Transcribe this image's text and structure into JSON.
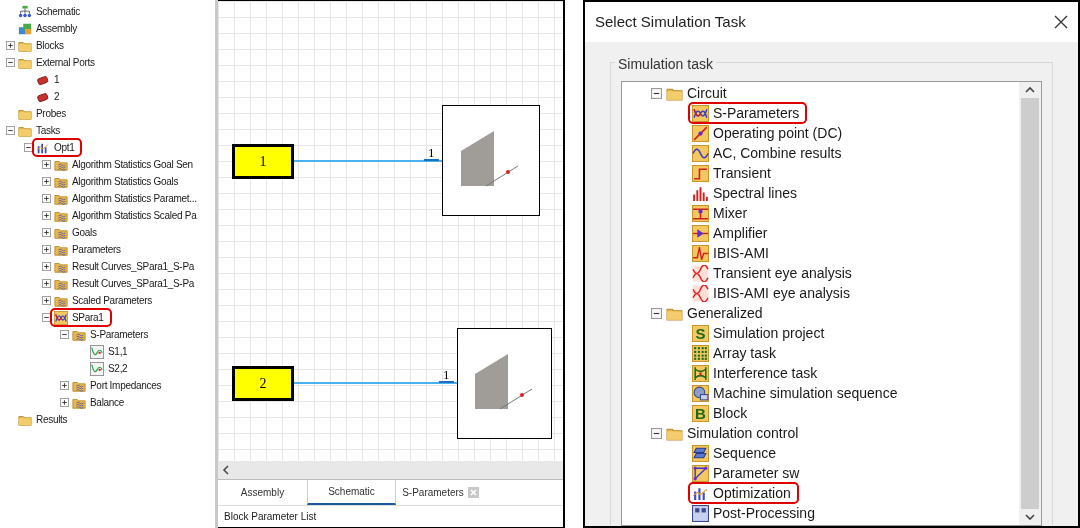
{
  "explorer": {
    "items": [
      {
        "label": "Schematic",
        "kind": "schematic"
      },
      {
        "label": "Assembly",
        "kind": "assembly"
      },
      {
        "label": "Blocks",
        "kind": "folder",
        "expanded": false
      },
      {
        "label": "External Ports",
        "kind": "folder",
        "expanded": true,
        "children": [
          {
            "label": "1",
            "kind": "port"
          },
          {
            "label": "2",
            "kind": "port"
          }
        ]
      },
      {
        "label": "Probes",
        "kind": "folder"
      },
      {
        "label": "Tasks",
        "kind": "folder",
        "expanded": true,
        "children": [
          {
            "label": "Opt1",
            "kind": "optimization",
            "expanded": true,
            "highlighted": true,
            "children": [
              {
                "label": "Algorithm Statistics Goal Sen",
                "kind": "results",
                "expanded": false
              },
              {
                "label": "Algorithm Statistics Goals",
                "kind": "results",
                "expanded": false
              },
              {
                "label": "Algorithm Statistics Paramet...",
                "kind": "results",
                "expanded": false
              },
              {
                "label": "Algorithm Statistics Scaled Pa",
                "kind": "results",
                "expanded": false
              },
              {
                "label": "Goals",
                "kind": "results",
                "expanded": false
              },
              {
                "label": "Parameters",
                "kind": "results",
                "expanded": false
              },
              {
                "label": "Result Curves_SPara1_S-Pa",
                "kind": "results",
                "expanded": false
              },
              {
                "label": "Result Curves_SPara1_S-Pa",
                "kind": "results",
                "expanded": false
              },
              {
                "label": "Scaled Parameters",
                "kind": "results",
                "expanded": false
              },
              {
                "label": "SPara1",
                "kind": "sparameters",
                "expanded": true,
                "highlighted": true,
                "children": [
                  {
                    "label": "S-Parameters",
                    "kind": "results",
                    "expanded": true,
                    "children": [
                      {
                        "label": "S1,1",
                        "kind": "curve"
                      },
                      {
                        "label": "S2,2",
                        "kind": "curve"
                      }
                    ]
                  },
                  {
                    "label": "Port Impedances",
                    "kind": "results",
                    "expanded": false
                  },
                  {
                    "label": "Balance",
                    "kind": "results",
                    "expanded": false
                  }
                ]
              }
            ]
          }
        ]
      },
      {
        "label": "Results",
        "kind": "folder"
      }
    ]
  },
  "schematic": {
    "blocks": [
      {
        "label": "1",
        "pin_label": "1"
      },
      {
        "label": "2",
        "pin_label": "1"
      }
    ],
    "tabs": [
      {
        "label": "Assembly",
        "selected": false,
        "closable": false
      },
      {
        "label": "Schematic",
        "selected": true,
        "closable": false
      },
      {
        "label": "S-Parameters",
        "selected": false,
        "closable": true
      }
    ],
    "status": "Block Parameter List"
  },
  "dialog": {
    "title": "Select Simulation Task",
    "group_label": "Simulation task",
    "tree": [
      {
        "label": "Circuit",
        "kind": "folder",
        "expanded": true,
        "children": [
          {
            "label": "S-Parameters",
            "kind": "sparameters",
            "highlighted": true
          },
          {
            "label": "Operating point (DC)",
            "kind": "dc"
          },
          {
            "label": "AC, Combine results",
            "kind": "ac"
          },
          {
            "label": "Transient",
            "kind": "transient"
          },
          {
            "label": "Spectral lines",
            "kind": "spectral"
          },
          {
            "label": "Mixer",
            "kind": "mixer"
          },
          {
            "label": "Amplifier",
            "kind": "amplifier"
          },
          {
            "label": "IBIS-AMI",
            "kind": "ibis"
          },
          {
            "label": "Transient eye analysis",
            "kind": "eye"
          },
          {
            "label": "IBIS-AMI eye analysis",
            "kind": "eye"
          }
        ]
      },
      {
        "label": "Generalized",
        "kind": "folder",
        "expanded": true,
        "children": [
          {
            "label": "Simulation project",
            "kind": "letter",
            "icon_text": "S"
          },
          {
            "label": "Array task",
            "kind": "array"
          },
          {
            "label": "Interference task",
            "kind": "interference"
          },
          {
            "label": "Machine simulation sequence",
            "kind": "machine"
          },
          {
            "label": "Block",
            "kind": "letter",
            "icon_text": "B"
          }
        ]
      },
      {
        "label": "Simulation control",
        "kind": "folder",
        "expanded": true,
        "children": [
          {
            "label": "Sequence",
            "kind": "sequence"
          },
          {
            "label": "Parameter sw",
            "kind": "sweep"
          },
          {
            "label": "Optimization",
            "kind": "optimization",
            "highlighted": true
          },
          {
            "label": "Post-Processing",
            "kind": "postprocessing"
          }
        ]
      }
    ]
  }
}
